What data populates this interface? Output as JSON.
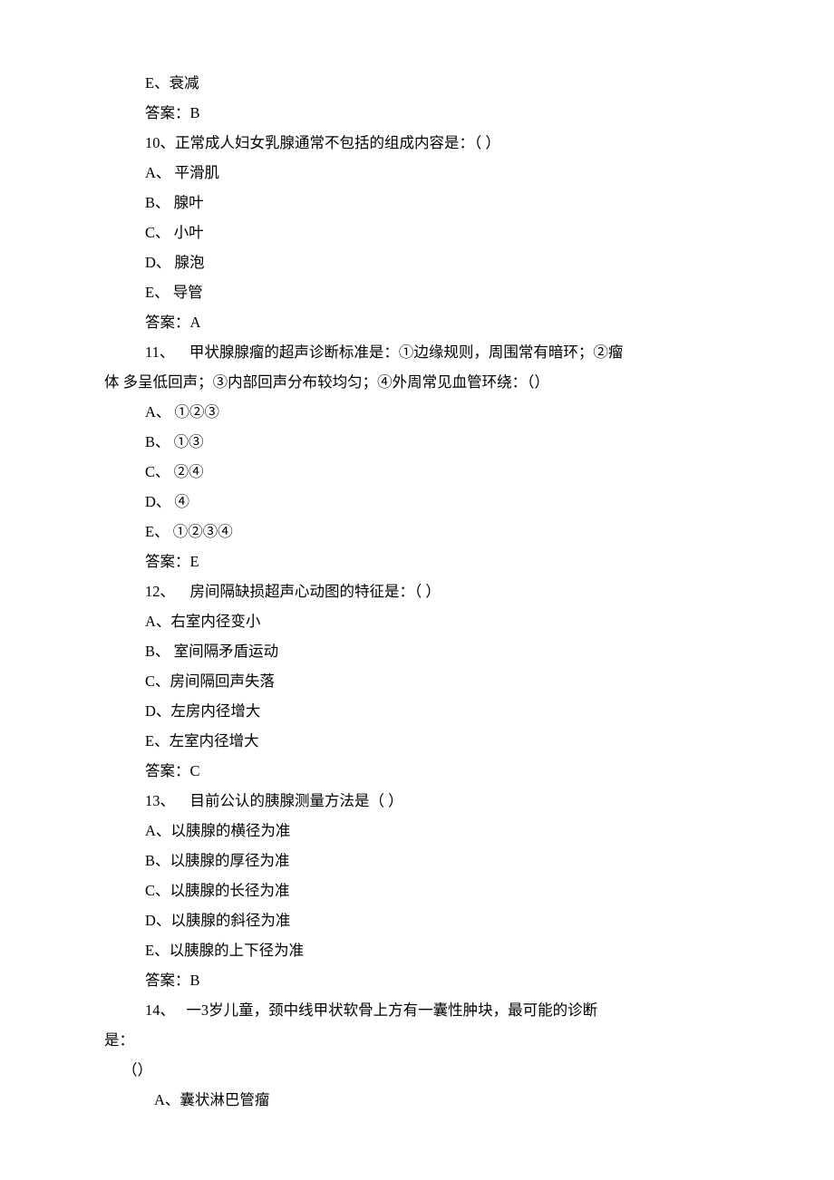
{
  "lines": [
    {
      "text": "E、衰减",
      "cls": "indent1"
    },
    {
      "text": "答案：B",
      "cls": "indent1"
    },
    {
      "text": "10、正常成人妇女乳腺通常不包括的组成内容是：（ ）",
      "cls": "indent1"
    },
    {
      "text": "A、 平滑肌",
      "cls": "indent1"
    },
    {
      "text": "B、 腺叶",
      "cls": "indent1"
    },
    {
      "text": "C、 小叶",
      "cls": "indent1"
    },
    {
      "text": "D、 腺泡",
      "cls": "indent1"
    },
    {
      "text": "E、 导管",
      "cls": "indent1"
    },
    {
      "text": "答案：A",
      "cls": "indent1"
    },
    {
      "text": "11、    甲状腺腺瘤的超声诊断标准是：①边缘规则，周围常有暗环；②瘤",
      "cls": "indent1"
    },
    {
      "text": "体 多呈低回声；③内部回声分布较均匀；④外周常见血管环绕：（）",
      "cls": "indent0"
    },
    {
      "text": "A、 ①②③",
      "cls": "indent1"
    },
    {
      "text": "B、 ①③",
      "cls": "indent1"
    },
    {
      "text": "C、 ②④",
      "cls": "indent1"
    },
    {
      "text": "D、 ④",
      "cls": "indent1"
    },
    {
      "text": "E、 ①②③④",
      "cls": "indent1"
    },
    {
      "text": "答案：E",
      "cls": "indent1"
    },
    {
      "text": "12、    房间隔缺损超声心动图的特征是：（ ）",
      "cls": "indent1"
    },
    {
      "text": "A、右室内径变小",
      "cls": "indent1"
    },
    {
      "text": "B、 室间隔矛盾运动",
      "cls": "indent1"
    },
    {
      "text": "C、房间隔回声失落",
      "cls": "indent1"
    },
    {
      "text": "D、左房内径增大",
      "cls": "indent1"
    },
    {
      "text": "E、左室内径增大",
      "cls": "indent1"
    },
    {
      "text": "答案：C",
      "cls": "indent1"
    },
    {
      "text": "13、    目前公认的胰腺测量方法是（ ）",
      "cls": "indent1"
    },
    {
      "text": "A、以胰腺的横径为准",
      "cls": "indent1"
    },
    {
      "text": "B、以胰腺的厚径为准",
      "cls": "indent1"
    },
    {
      "text": "C、以胰腺的长径为准",
      "cls": "indent1"
    },
    {
      "text": "D、以胰腺的斜径为准",
      "cls": "indent1"
    },
    {
      "text": "E、以胰腺的上下径为准",
      "cls": "indent1"
    },
    {
      "text": "答案：B",
      "cls": "indent1"
    },
    {
      "text": "14、   一3岁儿童，颈中线甲状软骨上方有一囊性肿块，最可能的诊断",
      "cls": "indent1"
    },
    {
      "text": "是：",
      "cls": "indent0"
    },
    {
      "text": "（）",
      "cls": "indent-alt"
    },
    {
      "text": "A、囊状淋巴管瘤",
      "cls": "indent2"
    }
  ]
}
